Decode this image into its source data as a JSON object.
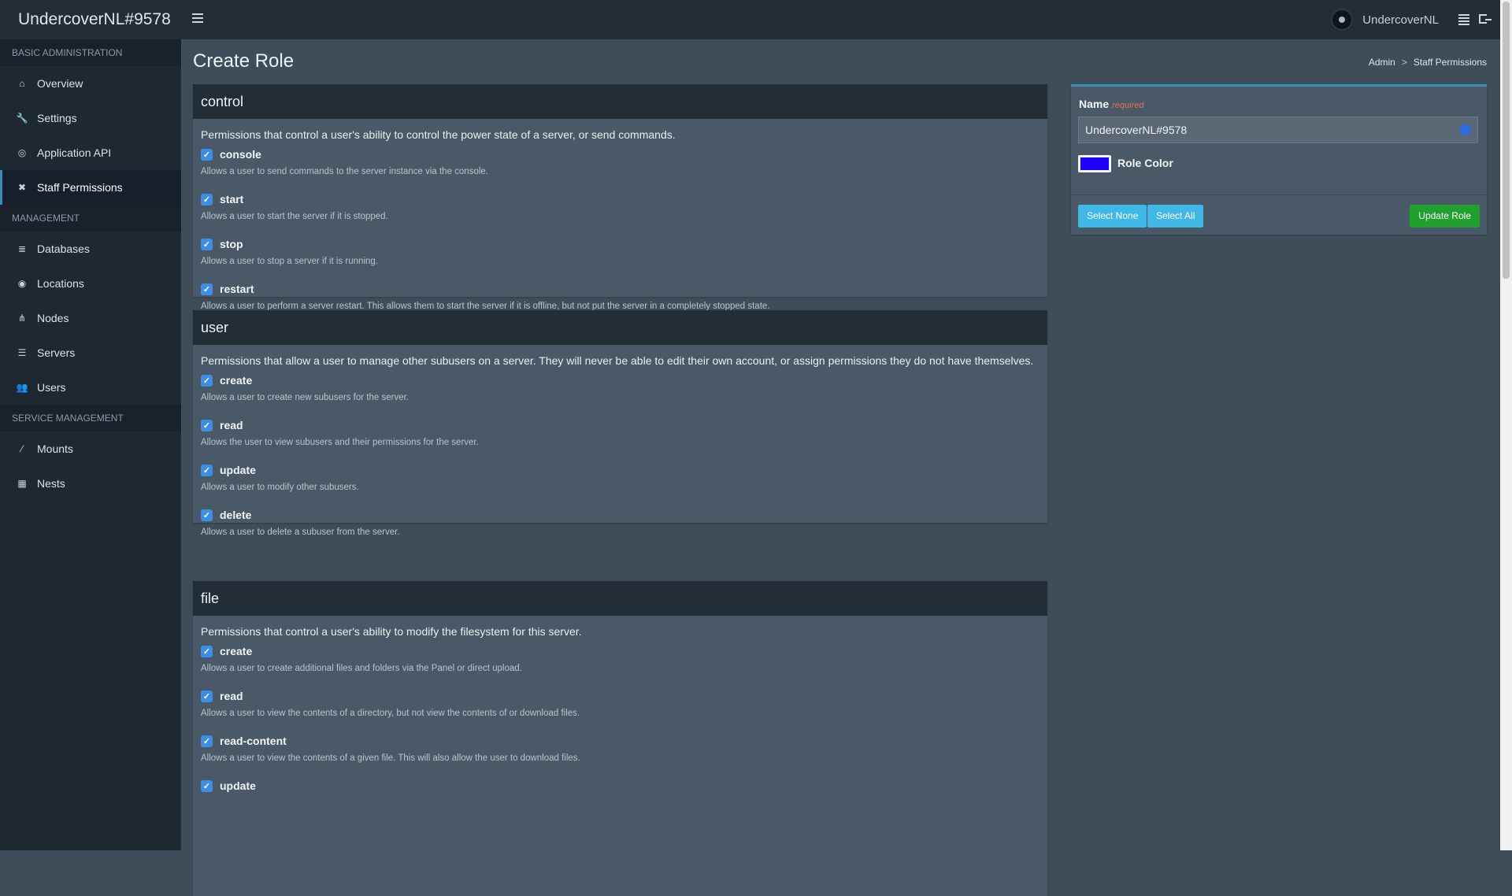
{
  "app": {
    "brand": "UndercoverNL#9578"
  },
  "topbar": {
    "user_name": "UndercoverNL"
  },
  "sidebar": {
    "sections": [
      {
        "title": "BASIC ADMINISTRATION",
        "items": [
          {
            "label": "Overview",
            "icon": "home-icon"
          },
          {
            "label": "Settings",
            "icon": "wrench-icon"
          },
          {
            "label": "Application API",
            "icon": "gamepad-icon"
          },
          {
            "label": "Staff Permissions",
            "icon": "times-icon",
            "active": true
          }
        ]
      },
      {
        "title": "MANAGEMENT",
        "items": [
          {
            "label": "Databases",
            "icon": "database-icon"
          },
          {
            "label": "Locations",
            "icon": "globe-icon"
          },
          {
            "label": "Nodes",
            "icon": "sitemap-icon"
          },
          {
            "label": "Servers",
            "icon": "server-icon"
          },
          {
            "label": "Users",
            "icon": "users-icon"
          }
        ]
      },
      {
        "title": "SERVICE MANAGEMENT",
        "items": [
          {
            "label": "Mounts",
            "icon": "magic-icon"
          },
          {
            "label": "Nests",
            "icon": "th-large-icon"
          }
        ]
      }
    ]
  },
  "page": {
    "title": "Create Role",
    "breadcrumb": [
      "Admin",
      ">",
      "Staff Permissions"
    ]
  },
  "panels": [
    {
      "title": "control",
      "description": "Permissions that control a user's ability to control the power state of a server, or send commands.",
      "permissions": [
        {
          "name": "console",
          "help": "Allows a user to send commands to the server instance via the console.",
          "checked": true
        },
        {
          "name": "start",
          "help": "Allows a user to start the server if it is stopped.",
          "checked": true
        },
        {
          "name": "stop",
          "help": "Allows a user to stop a server if it is running.",
          "checked": true
        },
        {
          "name": "restart",
          "help": "Allows a user to perform a server restart. This allows them to start the server if it is offline, but not put the server in a completely stopped state.",
          "checked": true
        }
      ]
    },
    {
      "title": "user",
      "description": "Permissions that allow a user to manage other subusers on a server. They will never be able to edit their own account, or assign permissions they do not have themselves.",
      "permissions": [
        {
          "name": "create",
          "help": "Allows a user to create new subusers for the server.",
          "checked": true
        },
        {
          "name": "read",
          "help": "Allows the user to view subusers and their permissions for the server.",
          "checked": true
        },
        {
          "name": "update",
          "help": "Allows a user to modify other subusers.",
          "checked": true
        },
        {
          "name": "delete",
          "help": "Allows a user to delete a subuser from the server.",
          "checked": true
        }
      ]
    },
    {
      "title": "file",
      "description": "Permissions that control a user's ability to modify the filesystem for this server.",
      "permissions": [
        {
          "name": "create",
          "help": "Allows a user to create additional files and folders via the Panel or direct upload.",
          "checked": true
        },
        {
          "name": "read",
          "help": "Allows a user to view the contents of a directory, but not view the contents of or download files.",
          "checked": true
        },
        {
          "name": "read-content",
          "help": "Allows a user to view the contents of a given file. This will also allow the user to download files.",
          "checked": true
        },
        {
          "name": "update",
          "help": "",
          "checked": true
        }
      ]
    }
  ],
  "role_form": {
    "name_label": "Name",
    "required_label": "required",
    "name_value": "UndercoverNL#9578",
    "color_label": "Role Color",
    "color_value": "#1e00ff",
    "select_none_label": "Select None",
    "select_all_label": "Select All",
    "update_label": "Update Role"
  },
  "colors": {
    "accent": "#3c8dbc",
    "info": "#3fb8e8",
    "success": "#1fa02f",
    "checkbox": "#3d8ee6"
  }
}
